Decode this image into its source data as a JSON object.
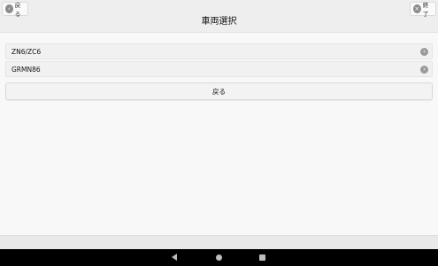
{
  "header": {
    "title": "車両選択",
    "back_label": "戻る",
    "end_label": "終了",
    "back_icon": "‹",
    "end_icon": "×"
  },
  "vehicles": [
    {
      "label": "ZN6/ZC6",
      "chevron": "›"
    },
    {
      "label": "GRMN86",
      "chevron": "›"
    }
  ],
  "actions": {
    "back_label": "戻る"
  }
}
